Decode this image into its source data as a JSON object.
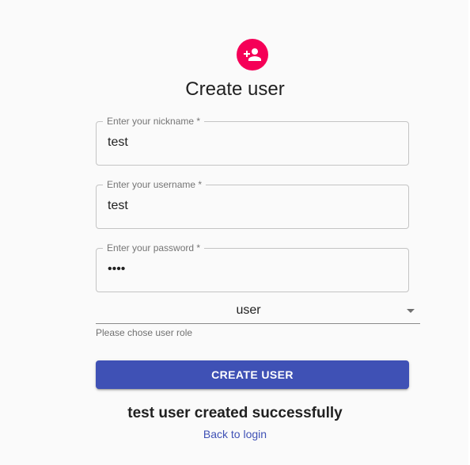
{
  "header": {
    "icon": "person-add-icon",
    "icon_color": "#f50057",
    "title": "Create user"
  },
  "form": {
    "nickname": {
      "label": "Enter your nickname *",
      "value": "test"
    },
    "username": {
      "label": "Enter your username *",
      "value": "test"
    },
    "password": {
      "label": "Enter your password *",
      "value": "test"
    },
    "role": {
      "value": "user",
      "helper": "Please chose user role"
    },
    "submit_label": "CREATE USER",
    "submit_color": "#3f51b5"
  },
  "status": {
    "message": "test user created successfully",
    "back_link": "Back to login",
    "link_color": "#3f51b5"
  }
}
